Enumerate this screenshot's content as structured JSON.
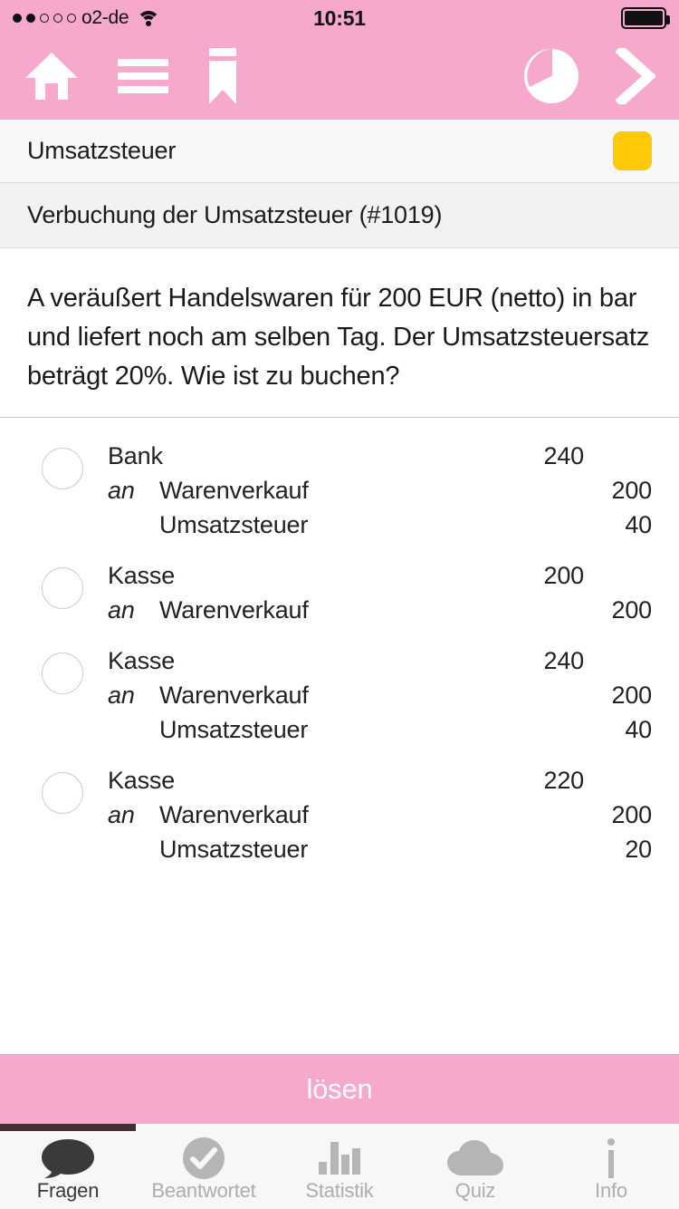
{
  "status_bar": {
    "carrier": "o2-de",
    "signal_dots_total": 5,
    "signal_dots_filled": 2,
    "wifi": "wifi-icon",
    "time": "10:51",
    "battery": "battery-full-icon"
  },
  "nav_bar": {
    "background_color": "#F6A8CD",
    "left_icons": [
      {
        "name": "home-icon",
        "label": "Home"
      },
      {
        "name": "menu-icon",
        "label": "Menü"
      },
      {
        "name": "bookmark-icon",
        "label": "Lesezeichen"
      }
    ],
    "right_icons": [
      {
        "name": "pie-chart-icon",
        "label": "Statistik"
      },
      {
        "name": "chevron-right-icon",
        "label": "Weiter"
      }
    ]
  },
  "topic": {
    "title": "Umsatzsteuer",
    "badge_color": "#FFC907",
    "badge_name": "difficulty-badge"
  },
  "question": {
    "title": "Verbuchung der Umsatzsteuer (#1019)",
    "number": "#1019",
    "text": "A veräußert Handelswaren für 200 EUR (netto) in bar und liefert noch am selben Tag. Der Umsatzsteuersatz beträgt 20%. Wie ist zu buchen?"
  },
  "answers": [
    {
      "id": "answer-1",
      "selected": false,
      "entries": [
        {
          "an": "",
          "account": "Bank",
          "amount": "240",
          "side": "debit"
        },
        {
          "an": "an",
          "account": "Warenverkauf",
          "amount": "200",
          "side": "credit"
        },
        {
          "an": "",
          "account": "Umsatzsteuer",
          "amount": "40",
          "side": "credit"
        }
      ]
    },
    {
      "id": "answer-2",
      "selected": false,
      "entries": [
        {
          "an": "",
          "account": "Kasse",
          "amount": "200",
          "side": "debit"
        },
        {
          "an": "an",
          "account": "Warenverkauf",
          "amount": "200",
          "side": "credit"
        }
      ]
    },
    {
      "id": "answer-3",
      "selected": false,
      "entries": [
        {
          "an": "",
          "account": "Kasse",
          "amount": "240",
          "side": "debit"
        },
        {
          "an": "an",
          "account": "Warenverkauf",
          "amount": "200",
          "side": "credit"
        },
        {
          "an": "",
          "account": "Umsatzsteuer",
          "amount": "40",
          "side": "credit"
        }
      ]
    },
    {
      "id": "answer-4",
      "selected": false,
      "entries": [
        {
          "an": "",
          "account": "Kasse",
          "amount": "220",
          "side": "debit"
        },
        {
          "an": "an",
          "account": "Warenverkauf",
          "amount": "200",
          "side": "credit"
        },
        {
          "an": "",
          "account": "Umsatzsteuer",
          "amount": "20",
          "side": "credit"
        }
      ]
    }
  ],
  "solve_button": {
    "label": "lösen",
    "background_color": "#F6A8CD",
    "text_color": "#FFFFFF"
  },
  "progress": {
    "percent": 20,
    "fill_color": "#443039"
  },
  "tab_bar": {
    "active_index": 0,
    "tabs": [
      {
        "label": "Fragen",
        "icon": "speech-bubble-icon"
      },
      {
        "label": "Beantwortet",
        "icon": "check-circle-icon"
      },
      {
        "label": "Statistik",
        "icon": "bar-chart-icon"
      },
      {
        "label": "Quiz",
        "icon": "cloud-icon"
      },
      {
        "label": "Info",
        "icon": "info-icon"
      }
    ]
  }
}
